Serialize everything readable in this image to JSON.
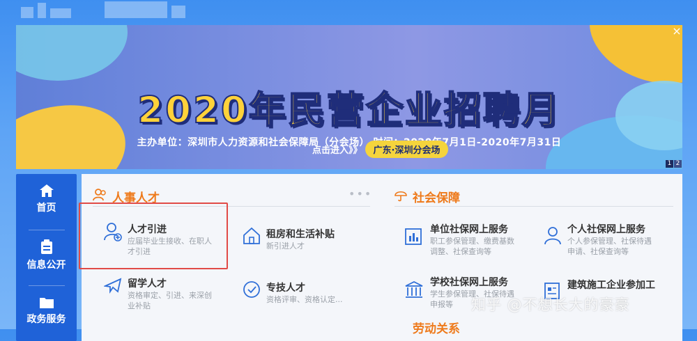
{
  "banner": {
    "title": "2020年民营企业招聘月",
    "subtitle": "主办单位：深圳市人力资源和社会保障局（分会场）   时间：2020年7月1日-2020年7月31日",
    "cta": "点击进入》》",
    "cta_pill": "广东·深圳分会场",
    "close": "×",
    "pages": [
      "1",
      "2"
    ]
  },
  "sidebar": {
    "items": [
      {
        "label": "首页",
        "icon": "home-icon"
      },
      {
        "label": "信息公开",
        "icon": "clipboard-icon"
      },
      {
        "label": "政务服务",
        "icon": "folder-icon"
      }
    ]
  },
  "talent": {
    "title": "人事人才",
    "more": "•••",
    "items": [
      {
        "title": "人才引进",
        "desc": "应届毕业生接收、在职人才引进",
        "icon": "user-add-icon"
      },
      {
        "title": "租房和生活补贴",
        "desc": "新引进人才",
        "icon": "house-icon"
      },
      {
        "title": "留学人才",
        "desc": "资格审定、引进、来深创业补贴",
        "icon": "airplane-icon"
      },
      {
        "title": "专技人才",
        "desc": "资格评审、资格认定...",
        "icon": "badge-icon"
      }
    ]
  },
  "social": {
    "title": "社会保障",
    "items": [
      {
        "title": "单位社保网上服务",
        "desc": "职工参保管理、缴费基数调整、社保查询等",
        "icon": "chart-building-icon"
      },
      {
        "title": "个人社保网上服务",
        "desc": "个人参保管理、社保待遇申请、社保查询等",
        "icon": "person-icon"
      },
      {
        "title": "学校社保网上服务",
        "desc": "学生参保管理、社保待遇申报等",
        "icon": "school-icon"
      },
      {
        "title": "建筑施工企业参加工",
        "desc": "",
        "icon": "document-icon"
      }
    ]
  },
  "labor": {
    "title": "劳动关系"
  },
  "watermark": "知乎 @不想长大的豪豪",
  "colors": {
    "accent": "#ee7a1b",
    "sidebar": "#1f62d8",
    "highlight": "#e14a46",
    "icon": "#2f6fd8"
  }
}
